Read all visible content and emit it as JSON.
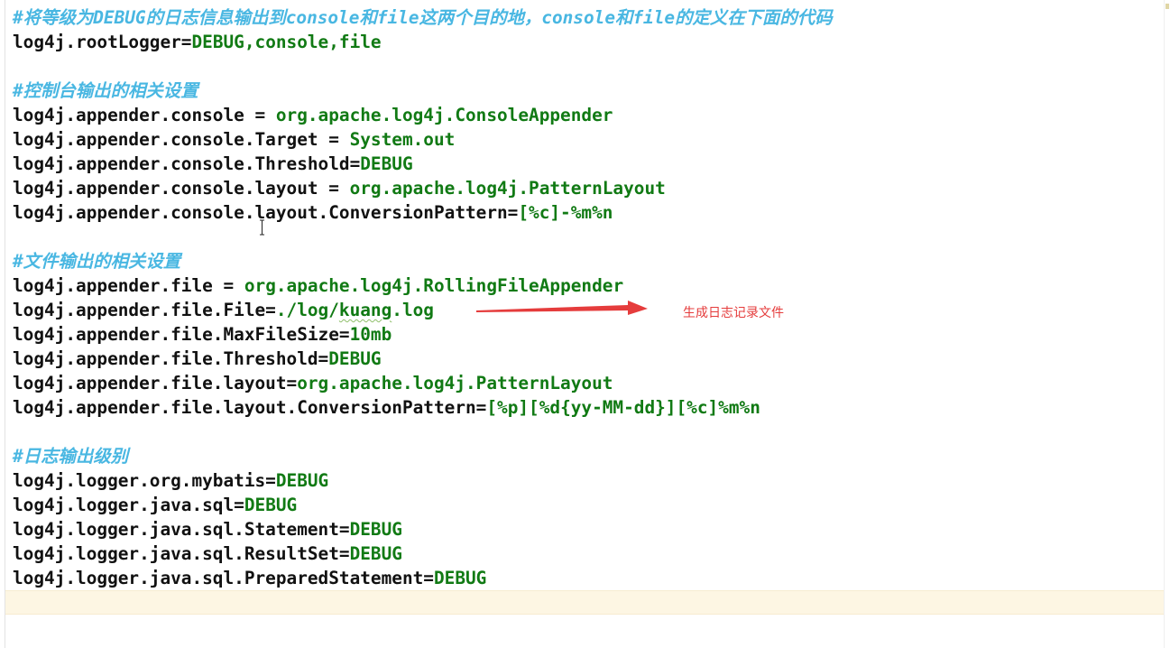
{
  "editor": {
    "lines": [
      {
        "segments": [
          {
            "t": "#将等级为DEBUG的日志信息输出到console和file这两个目的地，console和file的定义在下面的代码",
            "s": "c"
          }
        ]
      },
      {
        "segments": [
          {
            "t": "log4j.rootLogger=",
            "s": "k"
          },
          {
            "t": "DEBUG,console,file",
            "s": "v"
          }
        ]
      },
      {
        "segments": []
      },
      {
        "segments": [
          {
            "t": "#控制台输出的相关设置",
            "s": "c"
          }
        ]
      },
      {
        "segments": [
          {
            "t": "log4j.appender.console = ",
            "s": "k"
          },
          {
            "t": "org.apache.log4j.ConsoleAppender",
            "s": "v"
          }
        ]
      },
      {
        "segments": [
          {
            "t": "log4j.appender.console.Target = ",
            "s": "k"
          },
          {
            "t": "System.out",
            "s": "v"
          }
        ]
      },
      {
        "segments": [
          {
            "t": "log4j.appender.console.Threshold=",
            "s": "k"
          },
          {
            "t": "DEBUG",
            "s": "v"
          }
        ]
      },
      {
        "segments": [
          {
            "t": "log4j.appender.console.layout = ",
            "s": "k"
          },
          {
            "t": "org.apache.log4j.PatternLayout",
            "s": "v"
          }
        ]
      },
      {
        "segments": [
          {
            "t": "log4j.appender.console.layout.ConversionPattern=",
            "s": "k"
          },
          {
            "t": "[%c]-%m%n",
            "s": "v"
          }
        ]
      },
      {
        "segments": []
      },
      {
        "segments": [
          {
            "t": "#文件输出的相关设置",
            "s": "c"
          }
        ]
      },
      {
        "segments": [
          {
            "t": "log4j.appender.file = ",
            "s": "k"
          },
          {
            "t": "org.apache.log4j.RollingFileAppender",
            "s": "v"
          }
        ]
      },
      {
        "segments": [
          {
            "t": "log4j.appender.file.File=",
            "s": "k"
          },
          {
            "t": "./log/",
            "s": "v"
          },
          {
            "t": "kuang",
            "s": "v wavy"
          },
          {
            "t": ".log",
            "s": "v"
          }
        ]
      },
      {
        "segments": [
          {
            "t": "log4j.appender.file.MaxFileSize=",
            "s": "k"
          },
          {
            "t": "10mb",
            "s": "v"
          }
        ]
      },
      {
        "segments": [
          {
            "t": "log4j.appender.file.Threshold=",
            "s": "k"
          },
          {
            "t": "DEBUG",
            "s": "v"
          }
        ]
      },
      {
        "segments": [
          {
            "t": "log4j.appender.file.layout=",
            "s": "k"
          },
          {
            "t": "org.apache.log4j.PatternLayout",
            "s": "v"
          }
        ]
      },
      {
        "segments": [
          {
            "t": "log4j.appender.file.layout.ConversionPattern=",
            "s": "k"
          },
          {
            "t": "[%p][%d{yy-MM-dd}][%c]%m%n",
            "s": "v"
          }
        ]
      },
      {
        "segments": []
      },
      {
        "segments": [
          {
            "t": "#日志输出级别",
            "s": "c"
          }
        ]
      },
      {
        "segments": [
          {
            "t": "log4j.logger.org.mybatis=",
            "s": "k"
          },
          {
            "t": "DEBUG",
            "s": "v"
          }
        ]
      },
      {
        "segments": [
          {
            "t": "log4j.logger.java.sql=",
            "s": "k"
          },
          {
            "t": "DEBUG",
            "s": "v"
          }
        ]
      },
      {
        "segments": [
          {
            "t": "log4j.logger.java.sql.Statement=",
            "s": "k"
          },
          {
            "t": "DEBUG",
            "s": "v"
          }
        ]
      },
      {
        "segments": [
          {
            "t": "log4j.logger.java.sql.ResultSet=",
            "s": "k"
          },
          {
            "t": "DEBUG",
            "s": "v"
          }
        ]
      },
      {
        "segments": [
          {
            "t": "log4j.logger.java.sql.PreparedStatement=",
            "s": "k"
          },
          {
            "t": "DEBUG",
            "s": "v"
          }
        ]
      },
      {
        "segments": []
      }
    ]
  },
  "annotation": {
    "text": "生成日志记录文件",
    "color": "#e53c3c"
  },
  "colors": {
    "comment": "#49b7e2",
    "key": "#111111",
    "value": "#117a14",
    "current_line": "#fdf6e3"
  }
}
